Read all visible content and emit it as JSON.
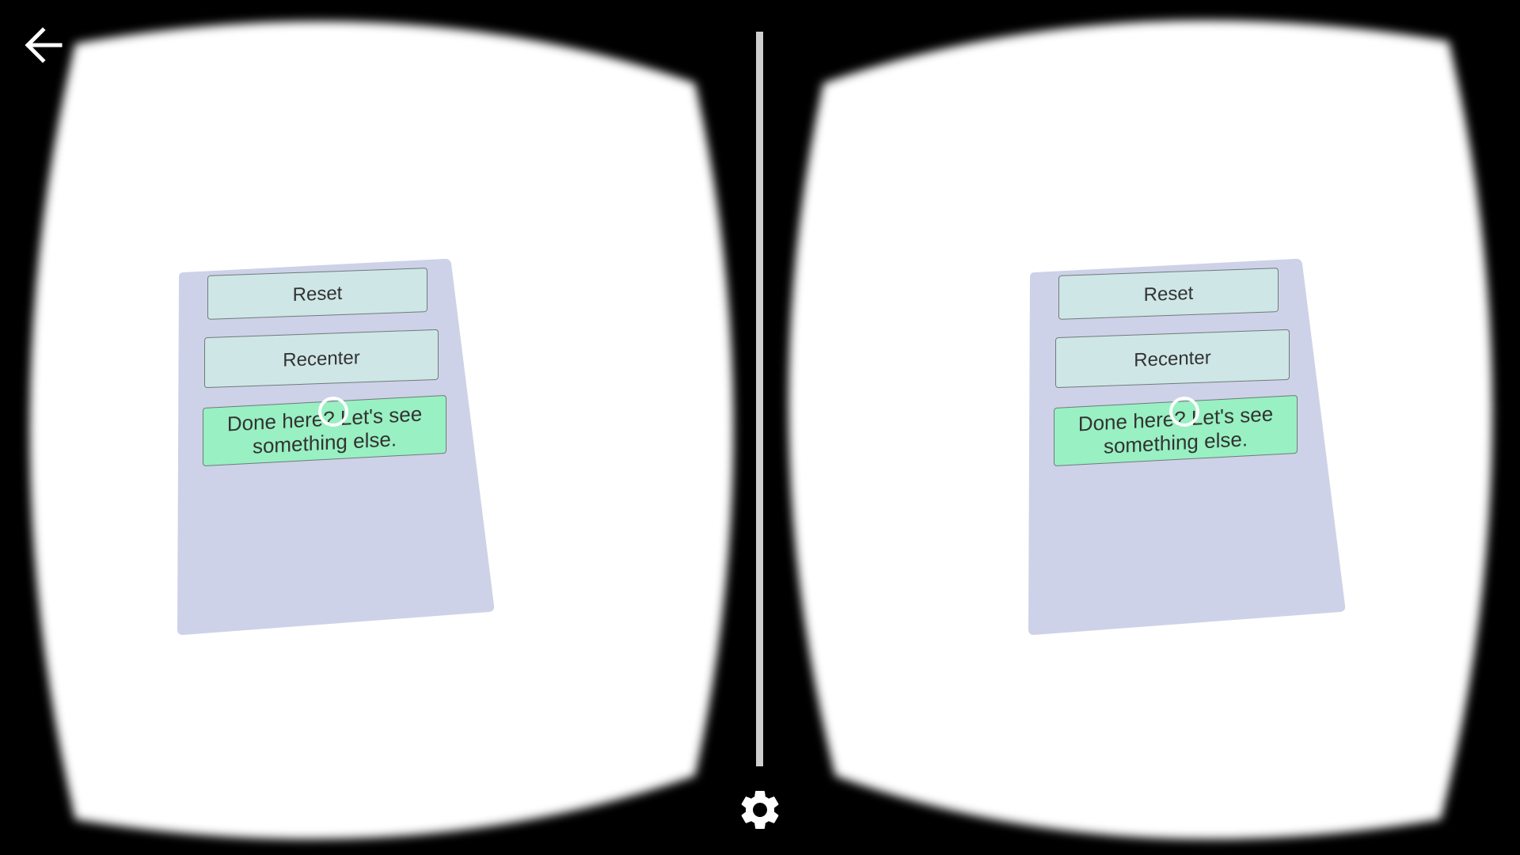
{
  "panel": {
    "reset_label": "Reset",
    "recenter_label": "Recenter",
    "done_label": "Done here? Let's see something else."
  },
  "colors": {
    "lens_background": "#ffffff",
    "panel_background": "#ced2e8",
    "button_grey": "#cfe6e6",
    "button_green": "#99f0c2",
    "frame": "#000000"
  },
  "icons": {
    "back": "arrow-left-icon",
    "settings": "gear-icon",
    "reticle": "gaze-reticle-icon"
  }
}
